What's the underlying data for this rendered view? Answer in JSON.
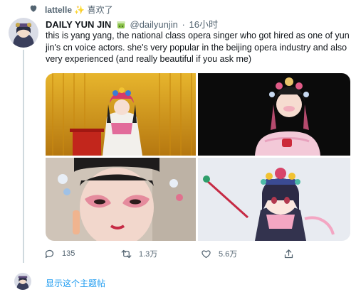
{
  "social_context": {
    "user": "lattelle",
    "sparkle": "✨",
    "action": "喜欢了",
    "icon": "heart-icon"
  },
  "tweet": {
    "author_name": "DAILY YUN JIN",
    "badge_icon": "bubble-tea-emoji",
    "handle": "@dailyunjin",
    "separator": "·",
    "time": "16小时",
    "text": "this is yang yang, the national class opera singer who got hired as one of yun jin's cn voice actors. she's very popular in the beijing opera industry and also very experienced (and really beautiful if you ask me)",
    "media": [
      {
        "icon": "photo-opera-stage"
      },
      {
        "icon": "photo-opera-portrait"
      },
      {
        "icon": "photo-opera-makeup-closeup"
      },
      {
        "icon": "illustration-yun-jin"
      }
    ],
    "actions": {
      "reply_count": "135",
      "retweet_count": "1.3万",
      "like_count": "5.6万"
    }
  },
  "thread": {
    "show_label": "显示这个主题帖"
  },
  "colors": {
    "accent": "#1d9bf0",
    "secondary_text": "#536471",
    "thread_line": "#cfd9de"
  }
}
